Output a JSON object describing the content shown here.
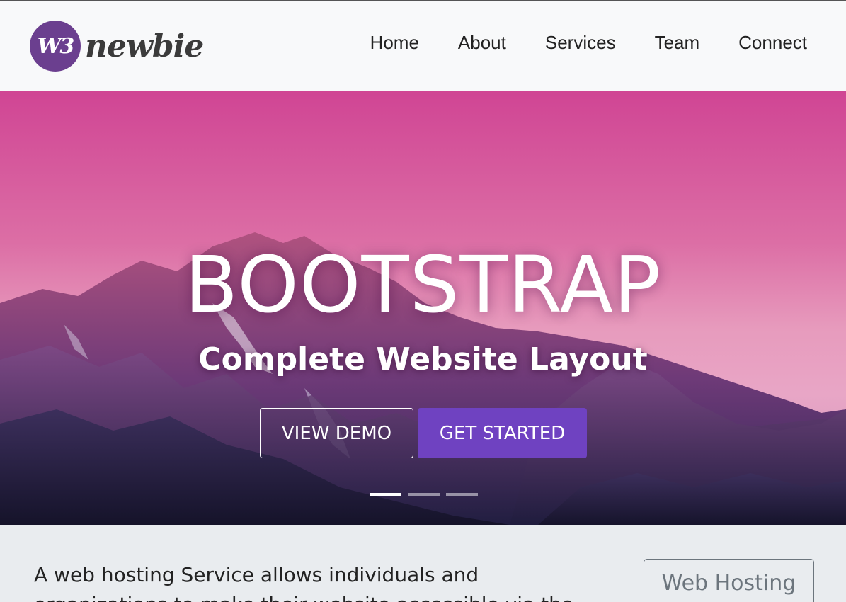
{
  "brand": {
    "badge_text": "W3",
    "name": "newbie",
    "badge_color": "#6b3f8f"
  },
  "nav": {
    "items": [
      {
        "label": "Home"
      },
      {
        "label": "About"
      },
      {
        "label": "Services"
      },
      {
        "label": "Team"
      },
      {
        "label": "Connect"
      }
    ]
  },
  "hero": {
    "title": "BOOTSTRAP",
    "subtitle": "Complete Website Layout",
    "view_demo_label": "VIEW DEMO",
    "get_started_label": "GET STARTED",
    "accent_color": "#6f42c1",
    "slides_count": 3,
    "active_slide": 1
  },
  "content": {
    "lead_text": "A web hosting Service allows individuals and organizations to make their website accessible via the",
    "web_hosting_button": "Web Hosting"
  }
}
